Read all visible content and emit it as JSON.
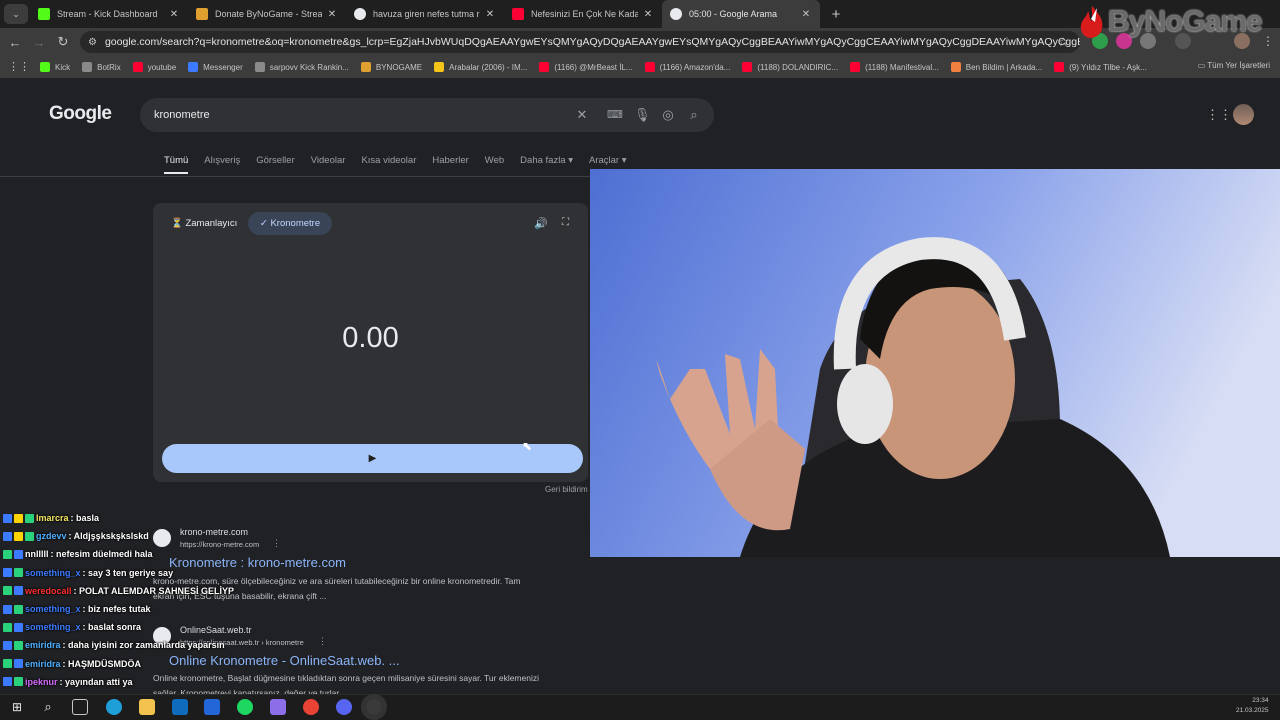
{
  "browser": {
    "tabs": [
      {
        "label": "Stream - Kick Dashboard",
        "color": "#53fc18"
      },
      {
        "label": "Donate ByNoGame - Streamer",
        "color": "#e0a030"
      },
      {
        "label": "havuza giren nefes tutma reel",
        "color": "#e8eaed"
      },
      {
        "label": "Nefesinizi En Çok Ne Kadar Tut",
        "color": "#ff0033"
      },
      {
        "label": "05:00 - Google Arama",
        "color": "#e8eaed"
      }
    ],
    "address": "google.com/search?q=kronometre&oq=kronometre&gs_lcrp=EgZjaHJvbWUqDQgAEAAYgwEYsQMYgAQyDQgAEAAYgwEYsQMYgAQyCggBEAAYiwMYgAQyCggCEAAYiwMYgAQyCggDEAAYiwMYgAQyCggEEAAYiwMYgAQyCggFEA...",
    "bookmarks": [
      {
        "label": "Kick",
        "color": "#53fc18"
      },
      {
        "label": "BotRix",
        "color": "#8a8a8a"
      },
      {
        "label": "youtube",
        "color": "#ff0033"
      },
      {
        "label": "Messenger",
        "color": "#3c7bff"
      },
      {
        "label": "sarpovv Kick Rankin...",
        "color": "#8a8a8a"
      },
      {
        "label": "BYNOGAME",
        "color": "#e0a030"
      },
      {
        "label": "Arabalar (2006) - IM...",
        "color": "#f5c518"
      },
      {
        "label": "(1166) @MrBeast İL...",
        "color": "#ff0033"
      },
      {
        "label": "(1166) Amazon'da...",
        "color": "#ff0033"
      },
      {
        "label": "(1188) DOLANDIRIC...",
        "color": "#ff0033"
      },
      {
        "label": "(1188) Manifestival...",
        "color": "#ff0033"
      },
      {
        "label": "Ben Bildim | Arkada...",
        "color": "#f08040"
      },
      {
        "label": "(9) Yıldız Tilbe - Aşk...",
        "color": "#ff0033"
      }
    ],
    "all_bookmarks": "Tüm Yer İşaretleri"
  },
  "google": {
    "logo": "Google",
    "query": "kronometre",
    "tabs": [
      "Tümü",
      "Alışveriş",
      "Görseller",
      "Videolar",
      "Kısa videolar",
      "Haberler",
      "Web",
      "Daha fazla ▾",
      "Araçlar ▾"
    ],
    "stopwatch": {
      "timer_tab": "⏳ Zamanlayıcı",
      "chrono_tab": "✓ Kronometre",
      "time": "0.00",
      "feedback": "Geri bildirim"
    },
    "results": [
      {
        "site": "krono-metre.com",
        "url": "https://krono-metre.com",
        "title": "Kronometre : krono-metre.com",
        "snippet1": "krono-metre.com, süre ölçebileceğiniz ve ara süreleri tutabileceğiniz bir online kronometredir. Tam",
        "snippet2": "ekran için, ESC tuşuna basabilir, ekrana çift ..."
      },
      {
        "site": "OnlineSaat.web.tr",
        "url": "https://onlinesaat.web.tr › kronometre",
        "title": "Online Kronometre - OnlineSaat.web. ...",
        "snippet1": "Online kronometre, Başlat düğmesine tıkladıktan sonra geçen milisaniye süresini sayar. Tur eklemenizi",
        "snippet2": "sağlar. Kronometreyi kapatırsanız, değer ve turlar ..."
      }
    ]
  },
  "chat": [
    {
      "user": "lmarcra",
      "color": "#f5e663",
      "msg": ": basla"
    },
    {
      "user": "gzdevv",
      "color": "#4fb0ff",
      "msg": ": Aldjşşkskşkslskd"
    },
    {
      "user": "nnlllll",
      "color": "#ffffff",
      "msg": ": nefesim düelmedi hala"
    },
    {
      "user": "something_x",
      "color": "#3c7bff",
      "msg": ": say 3 ten geriye say"
    },
    {
      "user": "weredocall",
      "color": "#ff3030",
      "msg": ": POLAT ALEMDAR SAHNESİ GELİYP"
    },
    {
      "user": "something_x",
      "color": "#3c7bff",
      "msg": ": biz nefes tutak"
    },
    {
      "user": "something_x",
      "color": "#3c7bff",
      "msg": ": baslat sonra"
    },
    {
      "user": "emiridra",
      "color": "#4fb0ff",
      "msg": ": daha iyisini zor zamanlarda yaparsın"
    },
    {
      "user": "emiridra",
      "color": "#4fb0ff",
      "msg": ": HAŞMDÜSMDÖA"
    },
    {
      "user": "ipeknur",
      "color": "#d66bff",
      "msg": ": yayından atti ya"
    }
  ],
  "brand": "ByNoGame",
  "taskbar": {
    "time": "23:34",
    "date": "21.03.2025"
  }
}
